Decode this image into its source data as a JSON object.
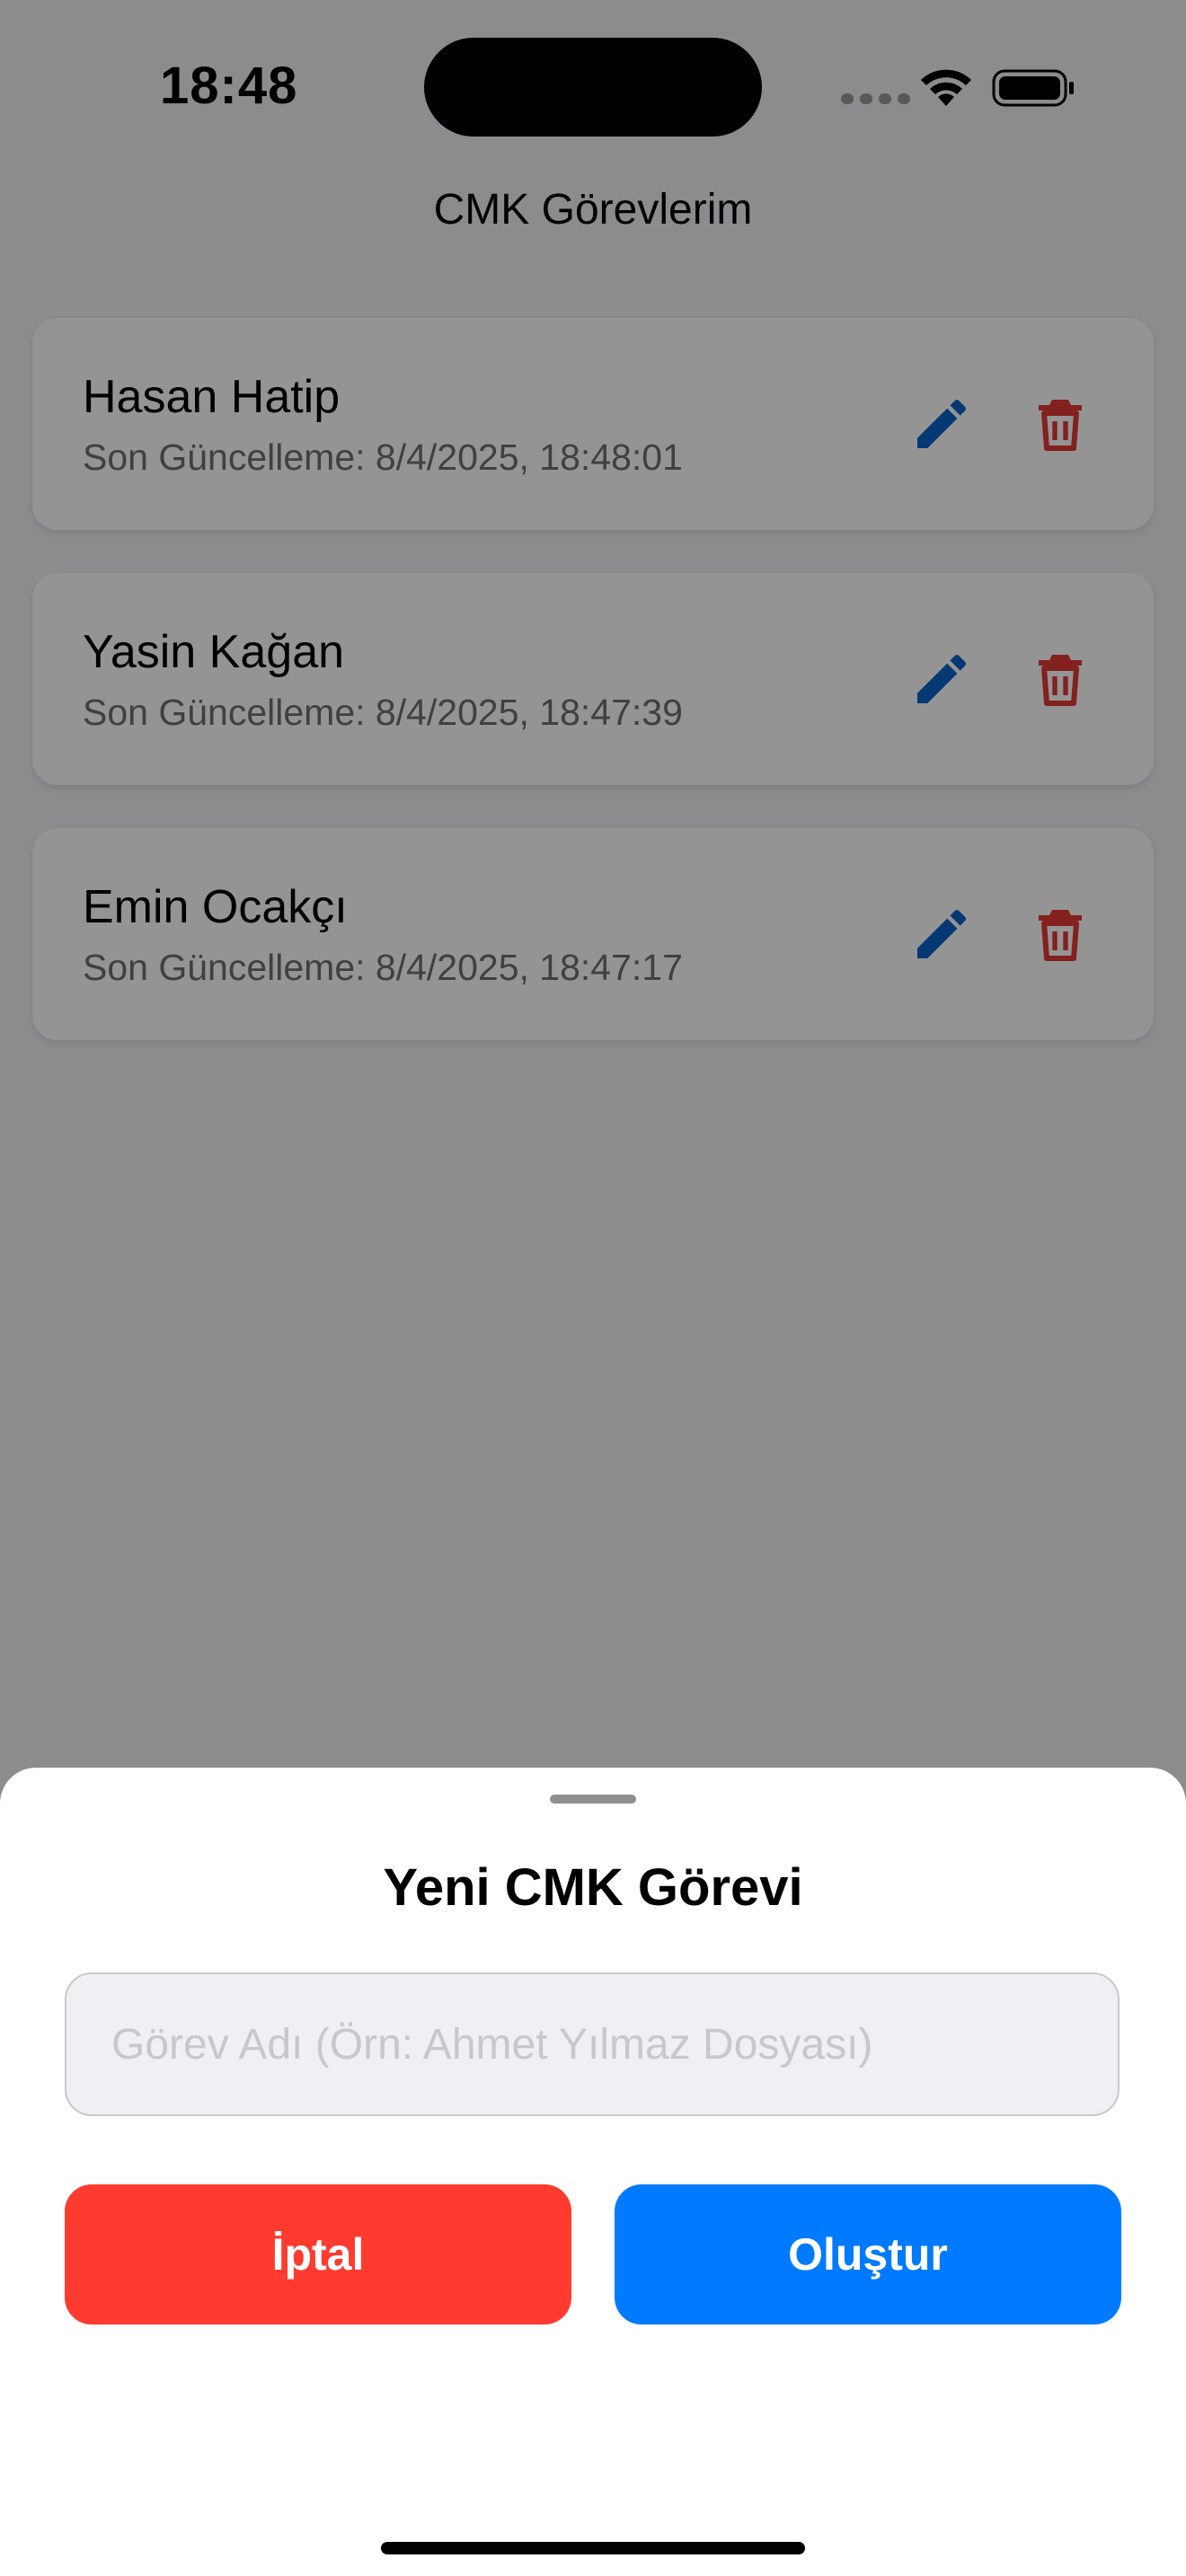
{
  "status_bar": {
    "time": "18:48",
    "icons": [
      "signal-icon",
      "wifi-icon",
      "battery-icon"
    ]
  },
  "nav": {
    "title": "CMK Görevlerim"
  },
  "tasks": [
    {
      "name": "Hasan Hatip",
      "updated": "Son Güncelleme: 8/4/2025, 18:48:01"
    },
    {
      "name": "Yasin Kağan",
      "updated": "Son Güncelleme: 8/4/2025, 18:47:39"
    },
    {
      "name": "Emin Ocakçı",
      "updated": "Son Güncelleme: 8/4/2025, 18:47:17"
    }
  ],
  "card_icons": {
    "edit": "pencil-icon",
    "delete": "trash-icon"
  },
  "sheet": {
    "title": "Yeni CMK Görevi",
    "input_value": "",
    "input_placeholder": "Görev Adı (Örn: Ahmet Yılmaz Dosyası)",
    "cancel_label": "İptal",
    "create_label": "Oluştur"
  },
  "colors": {
    "edit_icon": "#0a63c9",
    "delete_icon": "#e03a33",
    "cancel_button": "#ff3b30",
    "create_button": "#007aff",
    "background": "#f2f2f7"
  }
}
